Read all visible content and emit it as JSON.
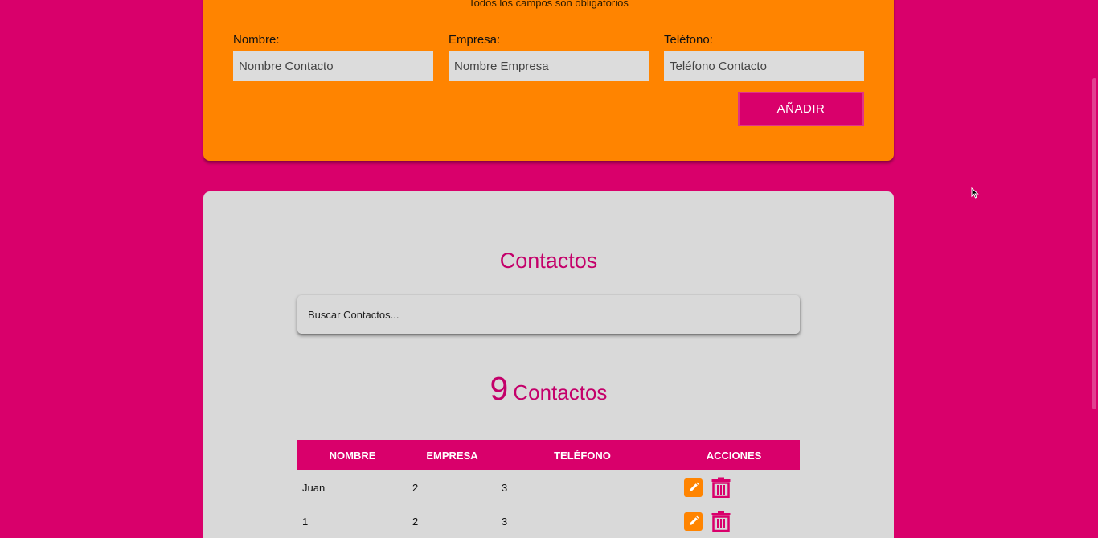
{
  "form": {
    "note": "Todos los campos son obligatorios",
    "fields": [
      {
        "label": "Nombre:",
        "placeholder": "Nombre Contacto"
      },
      {
        "label": "Empresa:",
        "placeholder": "Nombre Empresa"
      },
      {
        "label": "Teléfono:",
        "placeholder": "Teléfono Contacto"
      }
    ],
    "submit_label": "AÑADIR"
  },
  "contacts": {
    "title": "Contactos",
    "search_placeholder": "Buscar Contactos...",
    "count": "9",
    "count_label": "Contactos",
    "columns": [
      "NOMBRE",
      "EMPRESA",
      "TELÉFONO",
      "ACCIONES"
    ],
    "rows": [
      {
        "nombre": "Juan",
        "empresa": "2",
        "telefono": "3"
      },
      {
        "nombre": "1",
        "empresa": "2",
        "telefono": "3"
      }
    ]
  },
  "colors": {
    "background": "#d9006b",
    "form_card": "#ff8400",
    "contacts_card": "#d9d9d9",
    "accent_text": "#c4006a"
  },
  "icons": {
    "edit": "pencil-icon",
    "delete": "trash-icon"
  }
}
